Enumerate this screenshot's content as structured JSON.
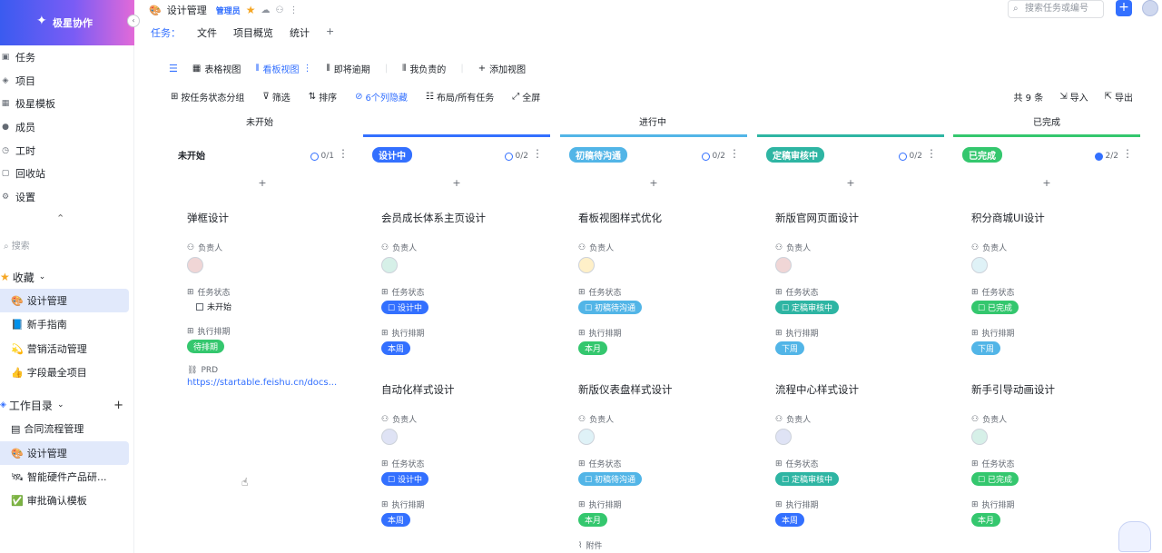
{
  "brand": {
    "name": "极星协作"
  },
  "sidebar": {
    "items": [
      {
        "label": "任务",
        "icon": "task-icon"
      },
      {
        "label": "项目",
        "icon": "stack-icon"
      },
      {
        "label": "极星模板",
        "icon": "template-icon"
      },
      {
        "label": "成员",
        "icon": "user-icon"
      },
      {
        "label": "工时",
        "icon": "clock-icon"
      },
      {
        "label": "回收站",
        "icon": "trash-icon"
      },
      {
        "label": "设置",
        "icon": "gear-icon"
      }
    ],
    "search_placeholder": "搜索",
    "favorites_title": "收藏",
    "favorites": [
      {
        "label": "设计管理",
        "icon": "🎨"
      },
      {
        "label": "新手指南",
        "icon": "📘"
      },
      {
        "label": "营销活动管理",
        "icon": "💫"
      },
      {
        "label": "字段最全项目",
        "icon": "👍"
      }
    ],
    "workdir_title": "工作目录",
    "workdir": [
      {
        "label": "合同流程管理",
        "icon": "▤"
      },
      {
        "label": "设计管理",
        "icon": "🎨"
      },
      {
        "label": "智能硬件产品研...",
        "icon": "🛰"
      },
      {
        "label": "审批确认模板",
        "icon": "✅"
      }
    ]
  },
  "header": {
    "title": "设计管理",
    "role": "管理员",
    "tabs": [
      "任务：",
      "文件",
      "项目概览",
      "统计"
    ],
    "search_placeholder": "搜索任务或编号"
  },
  "views": {
    "items": [
      "表格视图",
      "看板视图",
      "即将逾期",
      "我负责的",
      "添加视图"
    ],
    "active": "看板视图"
  },
  "toolbar": {
    "group": "按任务状态分组",
    "filter": "筛选",
    "sort": "排序",
    "hidden": "6个列隐藏",
    "layout": "布局/所有任务",
    "fullscreen": "全屏",
    "total": "共 9 条",
    "import": "导入",
    "export": "导出"
  },
  "groups": [
    "未开始",
    "进行中",
    "已完成"
  ],
  "columns": [
    {
      "title": "未开始",
      "count": "0/1",
      "color": "#ffffff",
      "pill": false
    },
    {
      "title": "设计中",
      "count": "0/2",
      "color": "#3370ff",
      "pill": true
    },
    {
      "title": "初稿待沟通",
      "count": "0/2",
      "color": "#52b5e7",
      "pill": true
    },
    {
      "title": "定稿审核中",
      "count": "0/2",
      "color": "#2eb5a3",
      "pill": true
    },
    {
      "title": "已完成",
      "count": "2/2",
      "color": "#34c76e",
      "pill": true
    }
  ],
  "labels": {
    "owner": "负责人",
    "state": "任务状态",
    "schedule": "执行排期",
    "prd": "PRD",
    "attach": "附件"
  },
  "cards": [
    {
      "title": "弹框设计",
      "state": "未开始",
      "sched": "待排期",
      "sched_color": "#34c76e",
      "prd": "https://startable.feishu.cn/docs..."
    },
    {
      "title": "会员成长体系主页设计",
      "state": "设计中",
      "sched": "本周"
    },
    {
      "title": "自动化样式设计",
      "state": "设计中",
      "sched": "本周"
    },
    {
      "title": "看板视图样式优化",
      "state": "初稿待沟通",
      "sched": "本月"
    },
    {
      "title": "新版仪表盘样式设计",
      "state": "初稿待沟通",
      "sched": "本月",
      "attach": "附件"
    },
    {
      "title": "新版官网页面设计",
      "state": "定稿审核中",
      "sched": "下周"
    },
    {
      "title": "流程中心样式设计",
      "state": "定稿审核中",
      "sched": "本周"
    },
    {
      "title": "积分商城UI设计",
      "state": "已完成",
      "sched": "下周"
    },
    {
      "title": "新手引导动画设计",
      "state": "已完成",
      "sched": "本月"
    }
  ]
}
